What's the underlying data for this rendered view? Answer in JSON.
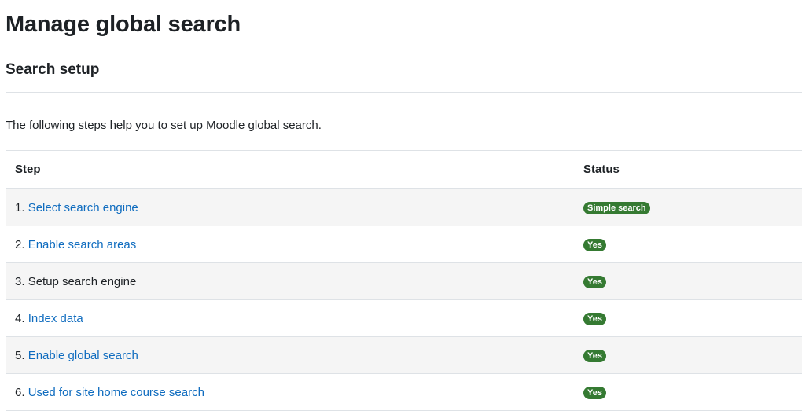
{
  "page": {
    "title": "Manage global search",
    "section_title": "Search setup",
    "intro": "The following steps help you to set up Moodle global search."
  },
  "table": {
    "headers": {
      "step": "Step",
      "status": "Status"
    },
    "rows": [
      {
        "num": "1.",
        "label": "Select search engine",
        "is_link": true,
        "status": "Simple search"
      },
      {
        "num": "2.",
        "label": "Enable search areas",
        "is_link": true,
        "status": "Yes"
      },
      {
        "num": "3.",
        "label": "Setup search engine",
        "is_link": false,
        "status": "Yes"
      },
      {
        "num": "4.",
        "label": "Index data",
        "is_link": true,
        "status": "Yes"
      },
      {
        "num": "5.",
        "label": "Enable global search",
        "is_link": true,
        "status": "Yes"
      },
      {
        "num": "6.",
        "label": "Used for site home course search",
        "is_link": true,
        "status": "Yes"
      }
    ]
  },
  "colors": {
    "link": "#0f6cbf",
    "badge_success": "#357a32",
    "text": "#1d2125",
    "row_stripe": "#f5f5f5",
    "border": "#dee2e6"
  }
}
